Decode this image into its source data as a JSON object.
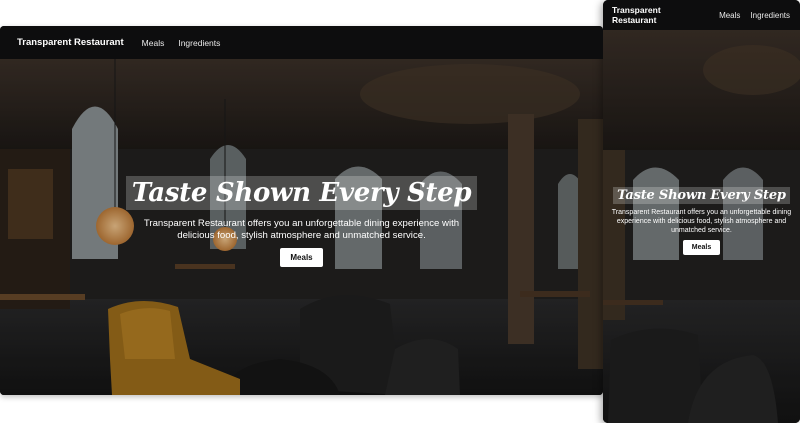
{
  "site": {
    "brand": "Transparent Restaurant",
    "nav": [
      {
        "label": "Meals"
      },
      {
        "label": "Ingredients"
      }
    ]
  },
  "hero": {
    "title": "Taste Shown Every Step",
    "subtitle": "Transparent Restaurant offers you an unforgettable dining experience with delicious food, stylish atmosphere and unmatched service.",
    "cta_label": "Meals"
  },
  "theme": {
    "navbar_bg": "#0d0d0e",
    "cta_bg": "#ffffff",
    "text_color": "#ffffff",
    "accent_chair": "#b07a1e"
  }
}
